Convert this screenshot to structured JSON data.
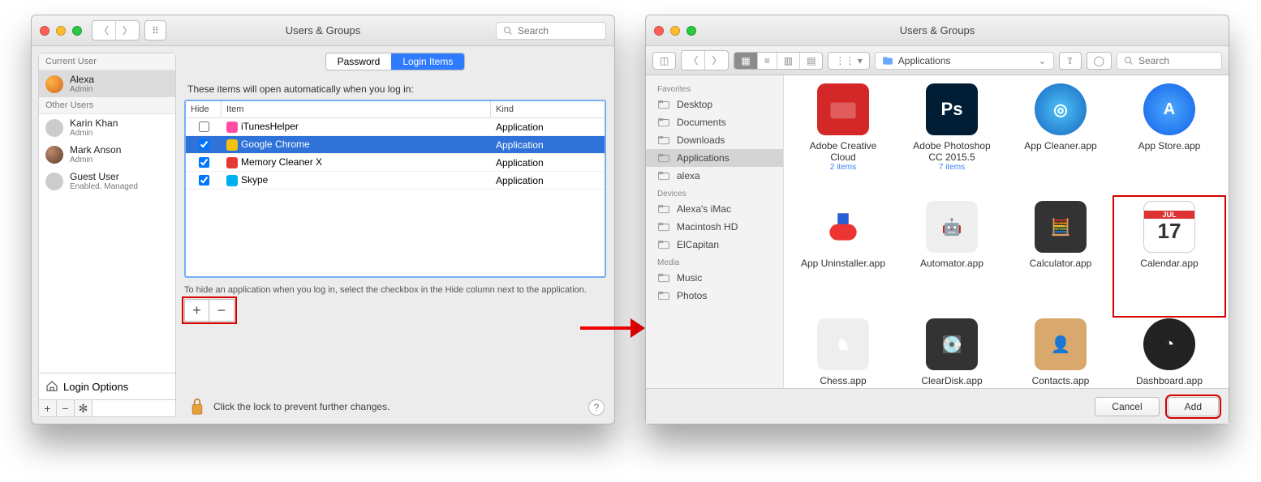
{
  "window_title": "Users & Groups",
  "search_placeholder": "Search",
  "sidebar1": {
    "header_current": "Current User",
    "header_other": "Other Users",
    "current": {
      "name": "Alexa",
      "role": "Admin"
    },
    "others": [
      {
        "name": "Karin Khan",
        "role": "Admin"
      },
      {
        "name": "Mark Anson",
        "role": "Admin"
      },
      {
        "name": "Guest User",
        "role": "Enabled, Managed"
      }
    ],
    "login_options": "Login Options"
  },
  "tabs": {
    "password": "Password",
    "login_items": "Login Items"
  },
  "hint": "These items will open automatically when you log in:",
  "table": {
    "cols": {
      "hide": "Hide",
      "item": "Item",
      "kind": "Kind"
    },
    "rows": [
      {
        "name": "iTunesHelper",
        "kind": "Application",
        "checked": false,
        "color": "#ff4da6",
        "sel": false
      },
      {
        "name": "Google Chrome",
        "kind": "Application",
        "checked": true,
        "color": "#f4c20d",
        "sel": true
      },
      {
        "name": "Memory Cleaner X",
        "kind": "Application",
        "checked": true,
        "color": "#e53935",
        "sel": false
      },
      {
        "name": "Skype",
        "kind": "Application",
        "checked": true,
        "color": "#00aff0",
        "sel": false
      }
    ]
  },
  "hint2": "To hide an application when you log in, select the checkbox in the Hide column next to the application.",
  "lock_text": "Click the lock to prevent further changes.",
  "finder": {
    "path": "Applications",
    "sidebar": {
      "favorites_label": "Favorites",
      "favorites": [
        "Desktop",
        "Documents",
        "Downloads",
        "Applications",
        "alexa"
      ],
      "devices_label": "Devices",
      "devices": [
        "Alexa's iMac",
        "Macintosh HD",
        "ElCapitan"
      ],
      "media_label": "Media",
      "media": [
        "Music",
        "Photos"
      ]
    },
    "items": [
      {
        "name": "Adobe Creative Cloud",
        "sub": "2 items",
        "t": "folder-red"
      },
      {
        "name": "Adobe Photoshop CC 2015.5",
        "sub": "7 items",
        "t": "ps"
      },
      {
        "name": "App Cleaner.app",
        "t": "appcleaner"
      },
      {
        "name": "App Store.app",
        "t": "appstore"
      },
      {
        "name": "App Uninstaller.app",
        "t": "uninstaller"
      },
      {
        "name": "Automator.app",
        "t": "automator"
      },
      {
        "name": "Calculator.app",
        "t": "calculator"
      },
      {
        "name": "Calendar.app",
        "t": "calendar",
        "hl": true
      },
      {
        "name": "Chess.app",
        "t": "chess"
      },
      {
        "name": "ClearDisk.app",
        "t": "cleardisk"
      },
      {
        "name": "Contacts.app",
        "t": "contacts"
      },
      {
        "name": "Dashboard.app",
        "t": "dashboard"
      }
    ],
    "cancel": "Cancel",
    "add": "Add"
  }
}
